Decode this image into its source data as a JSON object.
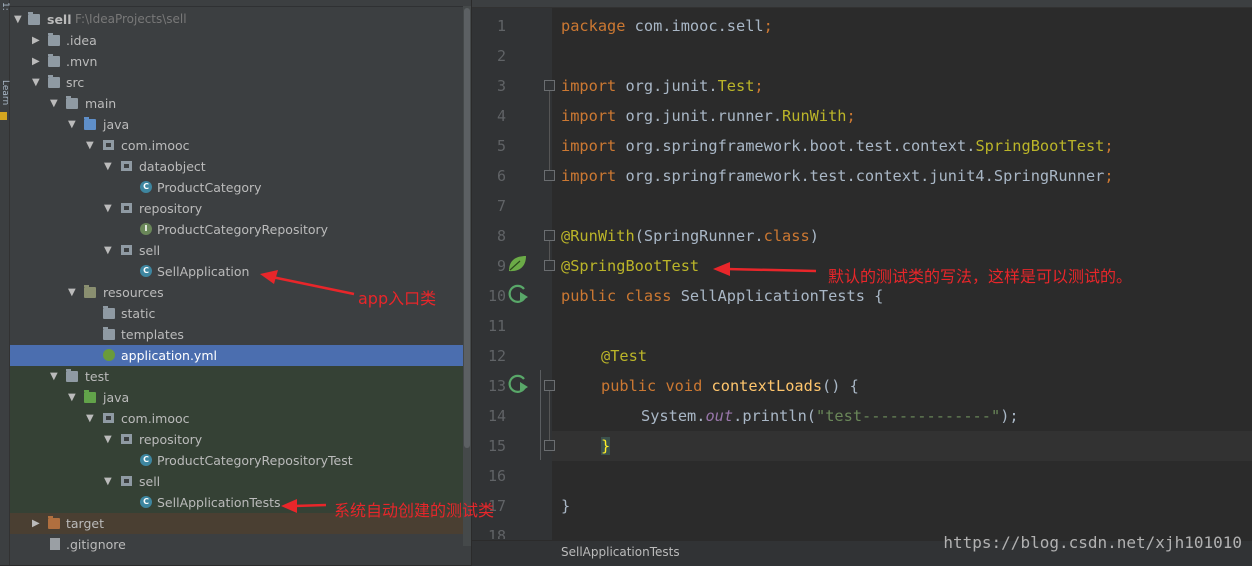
{
  "project": {
    "root_name": "sell",
    "root_path": "F:\\IdeaProjects\\sell",
    "items": [
      {
        "label": ".idea"
      },
      {
        "label": ".mvn"
      },
      {
        "label": "src"
      },
      {
        "label": "main"
      },
      {
        "label": "java"
      },
      {
        "label": "com.imooc"
      },
      {
        "label": "dataobject"
      },
      {
        "label": "ProductCategory"
      },
      {
        "label": "repository"
      },
      {
        "label": "ProductCategoryRepository"
      },
      {
        "label": "sell"
      },
      {
        "label": "SellApplication"
      },
      {
        "label": "resources"
      },
      {
        "label": "static"
      },
      {
        "label": "templates"
      },
      {
        "label": "application.yml"
      },
      {
        "label": "test"
      },
      {
        "label": "java"
      },
      {
        "label": "com.imooc"
      },
      {
        "label": "repository"
      },
      {
        "label": "ProductCategoryRepositoryTest"
      },
      {
        "label": "sell"
      },
      {
        "label": "SellApplicationTests"
      },
      {
        "label": "target"
      },
      {
        "label": ".gitignore"
      }
    ]
  },
  "editor": {
    "line_numbers": [
      "1",
      "2",
      "3",
      "4",
      "5",
      "6",
      "7",
      "8",
      "9",
      "10",
      "11",
      "12",
      "13",
      "14",
      "15",
      "16",
      "17",
      "18"
    ],
    "lines": {
      "l1a": "package",
      "l1b": " com.imooc.sell",
      "l1c": ";",
      "l3a": "import",
      "l3b": " org.junit.",
      "l3c": "Test",
      "l3d": ";",
      "l4a": "import",
      "l4b": " org.junit.runner.",
      "l4c": "RunWith",
      "l4d": ";",
      "l5a": "import",
      "l5b": " org.springframework.boot.test.context.",
      "l5c": "SpringBootTest",
      "l5d": ";",
      "l6a": "import",
      "l6b": " org.springframework.test.context.junit4.SpringRunner",
      "l6d": ";",
      "l8a": "@RunWith",
      "l8b": "(SpringRunner.",
      "l8c": "class",
      "l8d": ")",
      "l9a": "@SpringBootTest",
      "l10a": "public class",
      "l10b": " SellApplicationTests {",
      "l12a": "@Test",
      "l13a": "public void",
      "l13b": " contextLoads",
      "l13c": "() {",
      "l14a": "System.",
      "l14b": "out",
      "l14c": ".println(",
      "l14d": "\"test--------------\"",
      "l14e": ");",
      "l15a": "}",
      "l17a": "}"
    },
    "breadcrumb": "SellApplicationTests"
  },
  "annotations": {
    "app_entry": "app入口类",
    "default_test": "默认的测试类的写法，这样是可以测试的。",
    "auto_test": "系统自动创建的测试类"
  },
  "watermark": "https://blog.csdn.net/xjh101010",
  "colors": {
    "annotation": "#e8262a",
    "selection": "#4b6eaf",
    "keyword": "#cc7832",
    "annotation_code": "#bbb529"
  }
}
